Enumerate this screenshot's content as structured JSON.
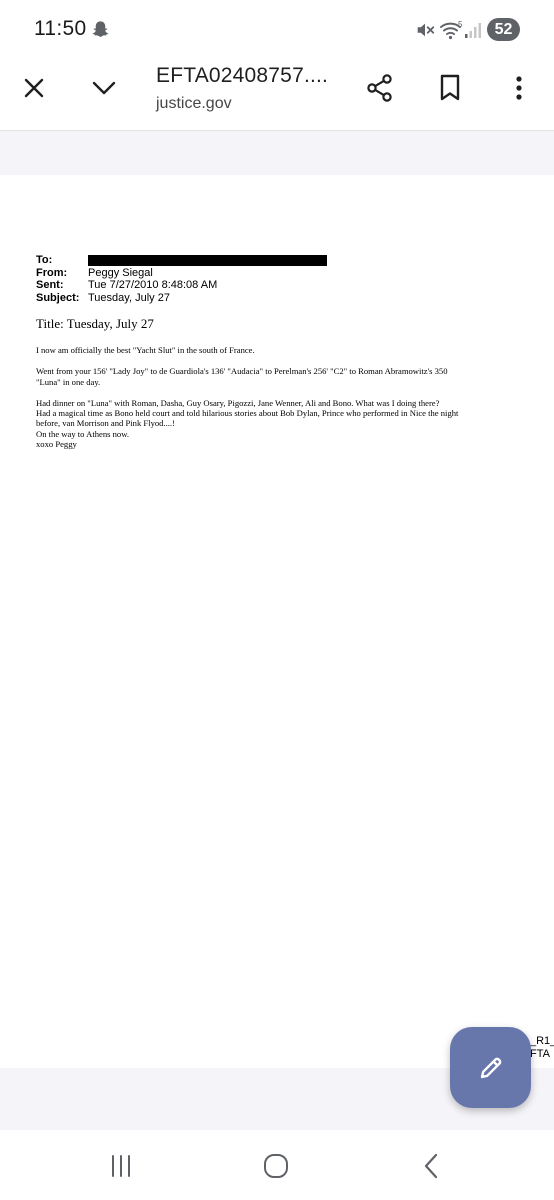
{
  "status_bar": {
    "time": "11:50",
    "battery": "52"
  },
  "header": {
    "title": "EFTA02408757....",
    "domain": "justice.gov",
    "icons": [
      "close-icon",
      "chevron-down-icon",
      "share-icon",
      "bookmark-icon",
      "more-vert-icon"
    ]
  },
  "document": {
    "meta": [
      {
        "label": "To:",
        "value": ""
      },
      {
        "label": "From:",
        "value": "Peggy Siegal"
      },
      {
        "label": "Sent:",
        "value": "Tue 7/27/2010 8:48:08 AM"
      },
      {
        "label": "Subject:",
        "value": "Tuesday, July 27"
      }
    ],
    "title": "Title: Tuesday, July 27",
    "body": {
      "p1": "I now am officially the best \"Yacht Slut\" in the south of France.",
      "p2_l1": "Went from your 156' \"Lady Joy\" to de Guardiola's 136' \"Audacia\" to Perelman's 256' \"C2\" to Roman Abramowitz's 350",
      "p2_l2": "\"Luna\" in one day.",
      "p3_l1": "Had dinner on \"Luna\" with Roman, Dasha, Guy Osary, Pigozzi, Jane Wenner, Ali and Bono.  What was I doing there?",
      "p3_l2": "Had a magical time as Bono held court and told hilarious stories about Bob Dylan, Prince who performed in Nice the night",
      "p3_l3": "before, van Morrison and Pink Flyod....!",
      "p3_l4": "On the way to Athens now.",
      "p3_l5": "xoxo Peggy"
    },
    "footer_fragment": {
      "line1": "_R1_",
      "line2": "FTA"
    }
  },
  "fab": {
    "icon": "pencil-icon"
  },
  "colors": {
    "fab": "#6776ab",
    "band": "#f5f4f8",
    "text": "#1f1f1f"
  }
}
